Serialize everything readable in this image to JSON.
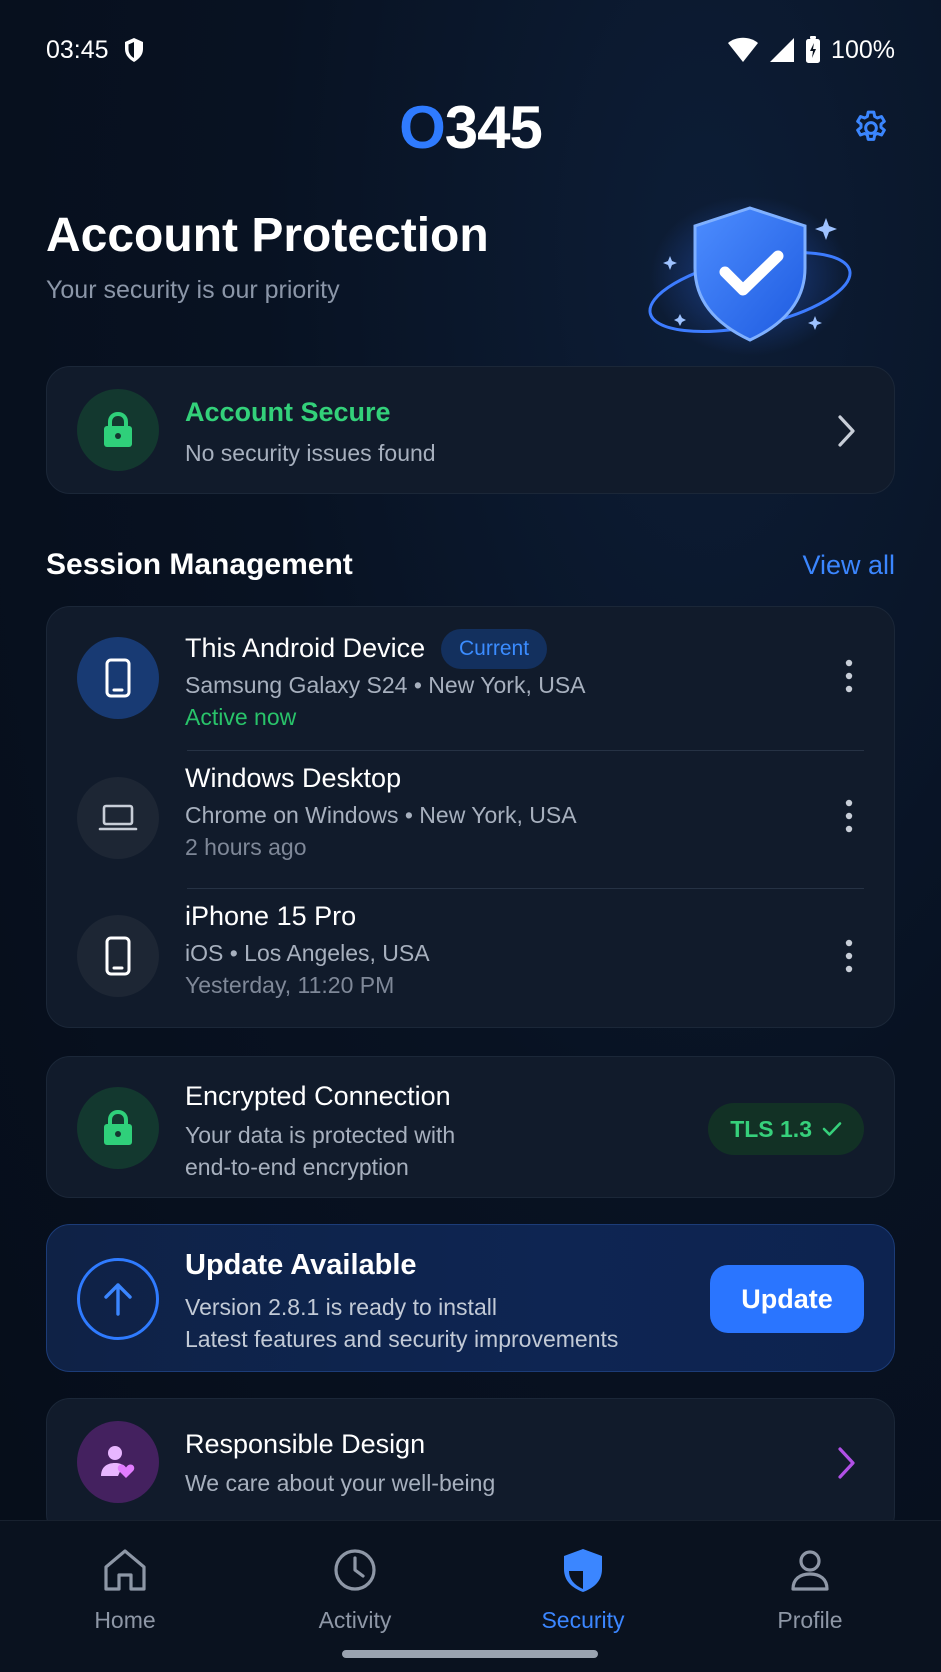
{
  "status_bar": {
    "time": "03:45",
    "battery": "100%"
  },
  "header": {
    "logo_accent": "O",
    "logo_rest": "345"
  },
  "hero": {
    "title": "Account Protection",
    "subtitle": "Your security is our priority"
  },
  "status_card": {
    "title": "Account Secure",
    "subtitle": "No security issues found"
  },
  "sessions": {
    "title": "Session Management",
    "view_all": "View all",
    "items": [
      {
        "name": "This Android Device",
        "badge": "Current",
        "detail": "Samsung Galaxy S24 • New York, USA",
        "time": "Active now"
      },
      {
        "name": "Windows Desktop",
        "detail": "Chrome on Windows • New York, USA",
        "time": "2 hours ago"
      },
      {
        "name": "iPhone 15 Pro",
        "detail": "iOS • Los Angeles, USA",
        "time": "Yesterday, 11:20 PM"
      }
    ]
  },
  "encryption": {
    "title": "Encrypted Connection",
    "line1": "Your data is protected with",
    "line2": "end-to-end encryption",
    "badge": "TLS 1.3"
  },
  "update": {
    "title": "Update Available",
    "line1": "Version 2.8.1 is ready to install",
    "line2": "Latest features and security improvements",
    "button": "Update"
  },
  "responsible": {
    "title": "Responsible Design",
    "subtitle": "We care about your well-being"
  },
  "nav": [
    {
      "label": "Home"
    },
    {
      "label": "Activity"
    },
    {
      "label": "Security"
    },
    {
      "label": "Profile"
    }
  ],
  "colors": {
    "accent": "#2f7bff",
    "success": "#29c36a",
    "purple": "#b150e6",
    "background": "#070f1c"
  }
}
